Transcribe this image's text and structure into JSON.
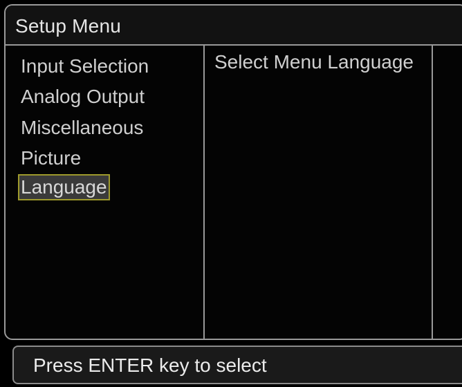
{
  "header": {
    "title": "Setup Menu"
  },
  "menu": {
    "items": [
      {
        "label": "Input Selection",
        "selected": false
      },
      {
        "label": "Analog Output",
        "selected": false
      },
      {
        "label": "Miscellaneous",
        "selected": false
      },
      {
        "label": "Picture",
        "selected": false
      },
      {
        "label": "Language",
        "selected": true
      }
    ]
  },
  "detail": {
    "text": "Select Menu Language"
  },
  "status": {
    "hint": "Press ENTER key to select"
  },
  "colors": {
    "background": "#000000",
    "border": "#9a9a9a",
    "selection_border": "#9e9a2c",
    "selection_fill": "#3a3a3a",
    "text": "#cfcfcf"
  }
}
